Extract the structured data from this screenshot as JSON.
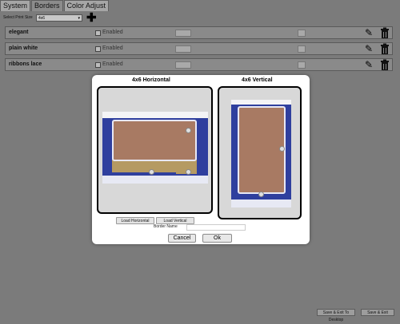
{
  "tabs": [
    "System",
    "Borders",
    "Color Adjust"
  ],
  "toolbar": {
    "print_size_label": "Select Print Size",
    "print_size_value": "4x6"
  },
  "borders": [
    {
      "name": "elegant",
      "enabled_label": "Enabled"
    },
    {
      "name": "plain white",
      "enabled_label": "Enabled"
    },
    {
      "name": "ribbons lace",
      "enabled_label": "Enabled"
    }
  ],
  "dialog": {
    "horizontal_title": "4x6 Horizontal",
    "vertical_title": "4x6 Vertical",
    "load_horizontal_label": "Load Horizontal",
    "load_vertical_label": "Load Vertical",
    "border_name_label": "Border Name",
    "border_name_value": "",
    "cancel_label": "Cancel",
    "ok_label": "Ok"
  },
  "footer": {
    "save_exit_desktop_label": "Save & Exit To Desktop",
    "save_exit_label": "Save & Exit"
  },
  "colors": {
    "background": "#7b7b7b",
    "frame_blue": "#2f3f9e",
    "photo_brown": "#a87a63",
    "gold_panel": "#b59a62"
  }
}
